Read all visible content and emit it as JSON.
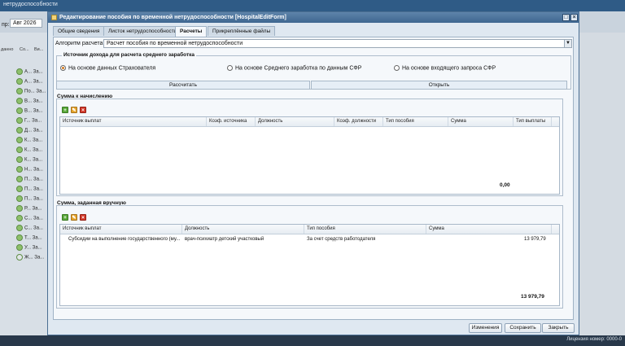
{
  "background": {
    "title": "нетрудоспособности",
    "period_label": "пр:",
    "period_value": "Авг 2026",
    "col_headers": [
      "данно",
      "Со...",
      "Ви..."
    ],
    "rows": [
      "А...",
      "А...",
      "По...",
      "В...",
      "В...",
      "Г...",
      "Д...",
      "К...",
      "К...",
      "К...",
      "Н...",
      "П...",
      "П...",
      "П...",
      "Р...",
      "С...",
      "С...",
      "Т...",
      "У...",
      "Ж..."
    ],
    "row_suffix": "За...",
    "license": "Лицензия номер: 0000-0"
  },
  "window": {
    "title": "Редактирование пособия по временной нетрудоспособности [HospitalEditForm]",
    "tabs": [
      "Общие сведения",
      "Листок нетрудоспособности",
      "Расчеты",
      "Прикреплённые файлы"
    ],
    "active_tab": 2
  },
  "calc": {
    "algorithm_label": "Алгоритм расчета:",
    "algorithm_value": "Расчет пособия по временной нетрудоспособности",
    "income_source_title": "Источник дохода для расчета среднего заработка",
    "income_options": [
      "На основе данных Страхователя",
      "На основе Среднего заработка по данным СФР",
      "На основе входящего запроса СФР"
    ],
    "income_selected": 0,
    "calculate_button": "Рассчитать",
    "open_button": "Открыть"
  },
  "accrual": {
    "title": "Сумма к начислению",
    "columns": [
      "Источник выплат",
      "Коэф. источника",
      "Должность",
      "Коэф. должности",
      "Тип пособия",
      "Сумма",
      "Тип выплаты"
    ],
    "rows": [],
    "total": "0,00"
  },
  "manual": {
    "title": "Сумма, заданная вручную",
    "columns": [
      "Источник выплат",
      "Должность",
      "Тип пособия",
      "Сумма"
    ],
    "rows": [
      {
        "source": "Субсидии на выполнение государственного (му...",
        "position": "врач-психиатр детский участковый",
        "benefit_type": "За счет средств работодателя",
        "amount": "13 979,79"
      }
    ],
    "total": "13 979,79"
  },
  "footer": {
    "changes": "Изменения",
    "save": "Сохранить",
    "close": "Закрыть"
  },
  "colors": {
    "title_bar": "#3e6690",
    "window_bg": "#dfe8f1",
    "radio_selected": "#d47a1e"
  }
}
